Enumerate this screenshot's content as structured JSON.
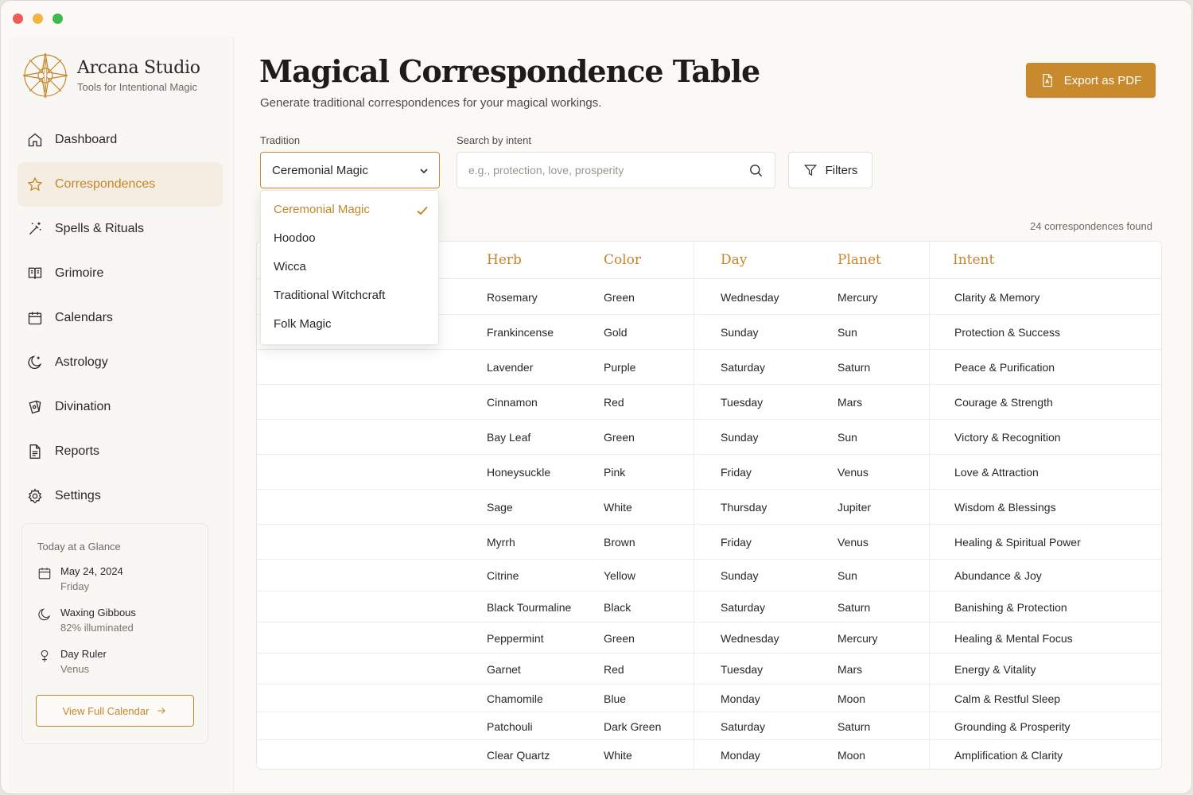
{
  "brand": {
    "name": "Arcana Studio",
    "tagline": "Tools for Intentional Magic"
  },
  "sidebar": {
    "items": [
      {
        "label": "Dashboard",
        "icon": "home-icon"
      },
      {
        "label": "Correspondences",
        "icon": "star-icon",
        "active": true
      },
      {
        "label": "Spells & Rituals",
        "icon": "magic-wand-icon"
      },
      {
        "label": "Grimoire",
        "icon": "book-icon"
      },
      {
        "label": "Calendars",
        "icon": "calendar-icon"
      },
      {
        "label": "Astrology",
        "icon": "moon-icon"
      },
      {
        "label": "Divination",
        "icon": "tarot-cards-icon"
      },
      {
        "label": "Reports",
        "icon": "document-icon"
      },
      {
        "label": "Settings",
        "icon": "gear-icon"
      }
    ]
  },
  "glance": {
    "title": "Today at a Glance",
    "date": "May 24, 2024",
    "weekday": "Friday",
    "moon_phase": "Waxing Gibbous",
    "moon_illumination": "82% illuminated",
    "day_ruler_label": "Day Ruler",
    "day_ruler": "Venus",
    "button": "View Full Calendar"
  },
  "header": {
    "title": "Magical Correspondence Table",
    "subtitle": "Generate traditional correspondences for your magical workings.",
    "export_label": "Export as PDF"
  },
  "controls": {
    "tradition_label": "Tradition",
    "tradition_value": "Ceremonial Magic",
    "search_label": "Search by intent",
    "search_placeholder": "e.g., protection, love, prosperity",
    "filters_label": "Filters",
    "result_count": "24 correspondences found"
  },
  "dropdown": {
    "options": [
      "Ceremonial Magic",
      "Hoodoo",
      "Wicca",
      "Traditional Witchcraft",
      "Folk Magic"
    ],
    "selected_index": 0
  },
  "table": {
    "columns": [
      "Herb",
      "Color",
      "Day",
      "Planet",
      "Intent"
    ],
    "rows": [
      [
        "Rosemary",
        "Green",
        "Wednesday",
        "Mercury",
        "Clarity & Memory"
      ],
      [
        "Frankincense",
        "Gold",
        "Sunday",
        "Sun",
        "Protection & Success"
      ],
      [
        "Lavender",
        "Purple",
        "Saturday",
        "Saturn",
        "Peace & Purification"
      ],
      [
        "Cinnamon",
        "Red",
        "Tuesday",
        "Mars",
        "Courage & Strength"
      ],
      [
        "Bay Leaf",
        "Green",
        "Sunday",
        "Sun",
        "Victory & Recognition"
      ],
      [
        "Honeysuckle",
        "Pink",
        "Friday",
        "Venus",
        "Love & Attraction"
      ],
      [
        "Sage",
        "White",
        "Thursday",
        "Jupiter",
        "Wisdom & Blessings"
      ],
      [
        "Myrrh",
        "Brown",
        "Friday",
        "Venus",
        "Healing & Spiritual Power"
      ],
      [
        "Citrine",
        "Yellow",
        "Sunday",
        "Sun",
        "Abundance & Joy"
      ],
      [
        "Black Tourmaline",
        "Black",
        "Saturday",
        "Saturn",
        "Banishing & Protection"
      ],
      [
        "Peppermint",
        "Green",
        "Wednesday",
        "Mercury",
        "Healing & Mental Focus"
      ],
      [
        "Garnet",
        "Red",
        "Tuesday",
        "Mars",
        "Energy & Vitality"
      ],
      [
        "Chamomile",
        "Blue",
        "Monday",
        "Moon",
        "Calm & Restful Sleep"
      ],
      [
        "Patchouli",
        "Dark Green",
        "Saturday",
        "Saturn",
        "Grounding & Prosperity"
      ],
      [
        "Clear Quartz",
        "White",
        "Monday",
        "Moon",
        "Amplification & Clarity"
      ]
    ]
  },
  "colors": {
    "accent": "#c98a2e",
    "background": "#faf9f6",
    "active_nav_bg": "#f5ede1"
  }
}
